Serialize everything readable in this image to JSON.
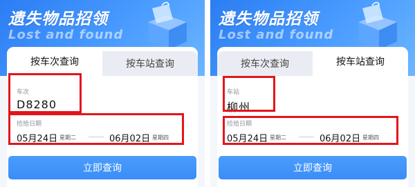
{
  "banner": {
    "title": "遗失物品招领",
    "subtitle": "Lost and found"
  },
  "tabs": {
    "by_train": "按车次查询",
    "by_station": "按车站查询"
  },
  "left": {
    "field_label": "车次",
    "field_value": "D8280"
  },
  "right": {
    "field_label": "车站",
    "field_value": "柳州"
  },
  "dates": {
    "label": "捡拾日期",
    "start_date": "05月24日",
    "start_weekday": "星期二",
    "end_date": "06月02日",
    "end_weekday": "星期四"
  },
  "query_button": "立即查询",
  "colors": {
    "banner_blue": "#2b7df3",
    "highlight_red": "#e4141b",
    "button_blue": "#3a8df7"
  }
}
